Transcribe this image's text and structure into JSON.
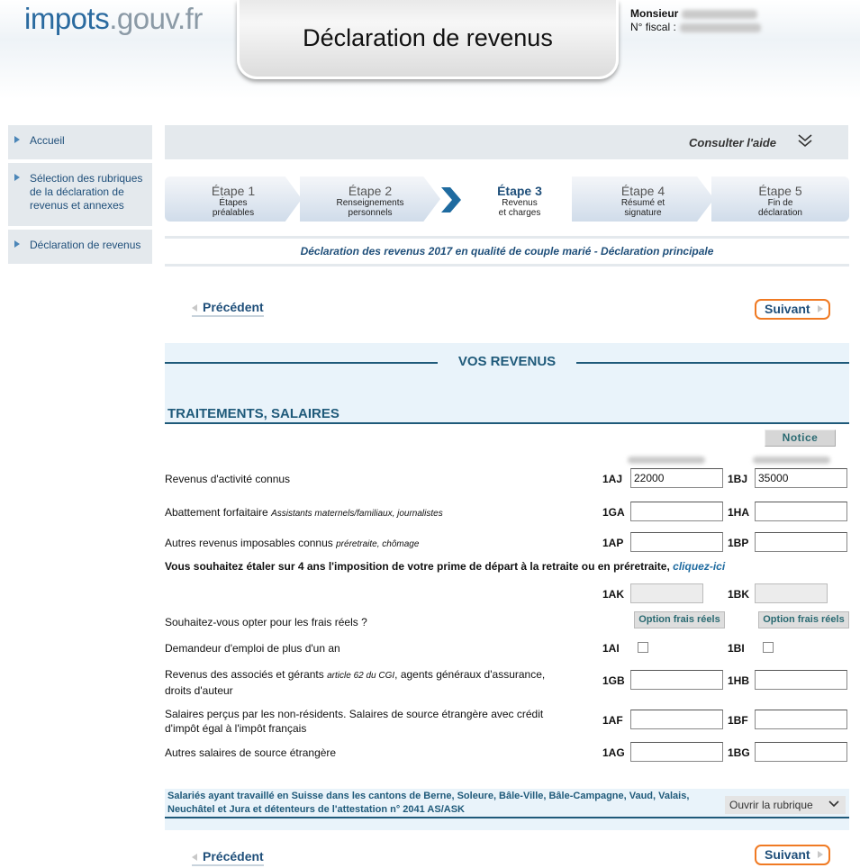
{
  "header": {
    "logo_main": "impots",
    "logo_light": ".gouv.fr",
    "title": "Déclaration de revenus",
    "user_label": "Monsieur",
    "fiscal_label": "N° fiscal :"
  },
  "sidebar": {
    "items": [
      {
        "label": "Accueil"
      },
      {
        "label": "Sélection des rubriques de la déclaration de revenus et annexes"
      },
      {
        "label": "Déclaration de revenus"
      }
    ]
  },
  "help": {
    "label": "Consulter l'aide"
  },
  "steps": [
    {
      "title": "Étape 1",
      "line1": "Étapes",
      "line2": "préalables"
    },
    {
      "title": "Étape 2",
      "line1": "Renseignements",
      "line2": "personnels"
    },
    {
      "title": "Étape 3",
      "line1": "Revenus",
      "line2": "et charges"
    },
    {
      "title": "Étape 4",
      "line1": "Résumé et",
      "line2": "signature"
    },
    {
      "title": "Étape 5",
      "line1": "Fin de",
      "line2": "déclaration"
    }
  ],
  "subtitle": "Déclaration des revenus 2017 en qualité de couple marié - Déclaration principale",
  "nav": {
    "prev": "Précédent",
    "next": "Suivant"
  },
  "panel": {
    "heading": "VOS REVENUS",
    "section": "TRAITEMENTS, SALAIRES",
    "notice": "Notice"
  },
  "rows": {
    "r1": {
      "label": "Revenus d'activité connus",
      "code1": "1AJ",
      "code2": "1BJ",
      "value1": "22000",
      "value2": "35000"
    },
    "r2": {
      "label": "Abattement forfaitaire",
      "note": "Assistants maternels/familiaux, journalistes",
      "code1": "1GA",
      "code2": "1HA"
    },
    "r3": {
      "label": "Autres revenus imposables connus",
      "note": "préretraite, chômage",
      "code1": "1AP",
      "code2": "1BP"
    },
    "q": {
      "text": "Vous souhaitez étaler sur 4 ans l'imposition de votre prime de départ à la retraite ou en préretraite,",
      "link": "cliquez-ici"
    },
    "r4": {
      "code1": "1AK",
      "code2": "1BK"
    },
    "r5": {
      "label": "Souhaitez-vous opter pour les frais réels ?",
      "btn": "Option frais réels"
    },
    "r6": {
      "label": "Demandeur d'emploi de plus d'un an",
      "code1": "1AI",
      "code2": "1BI"
    },
    "r7": {
      "label": "Revenus des associés et gérants",
      "note": "article 62 du CGI",
      "label2": ", agents généraux d'assurance,",
      "label3": "droits d'auteur",
      "code1": "1GB",
      "code2": "1HB"
    },
    "r8": {
      "label": "Salaires perçus par les non-résidents. Salaires de source étrangère avec crédit",
      "label2": "d'impôt égal à l'impôt français",
      "code1": "1AF",
      "code2": "1BF"
    },
    "r9": {
      "label": "Autres salaires de source étrangère",
      "code1": "1AG",
      "code2": "1BG"
    }
  },
  "swiss": {
    "text": "Salariés ayant travaillé en Suisse dans les cantons de Berne, Soleure, Bâle-Ville, Bâle-Campagne, Vaud, Valais, Neuchâtel et Jura et détenteurs de l'attestation n° 2041 AS/ASK",
    "open": "Ouvrir la rubrique"
  },
  "colors": {
    "primary": "#1f5a7a",
    "accent": "#f07a23",
    "panel": "#e9f3fa"
  }
}
